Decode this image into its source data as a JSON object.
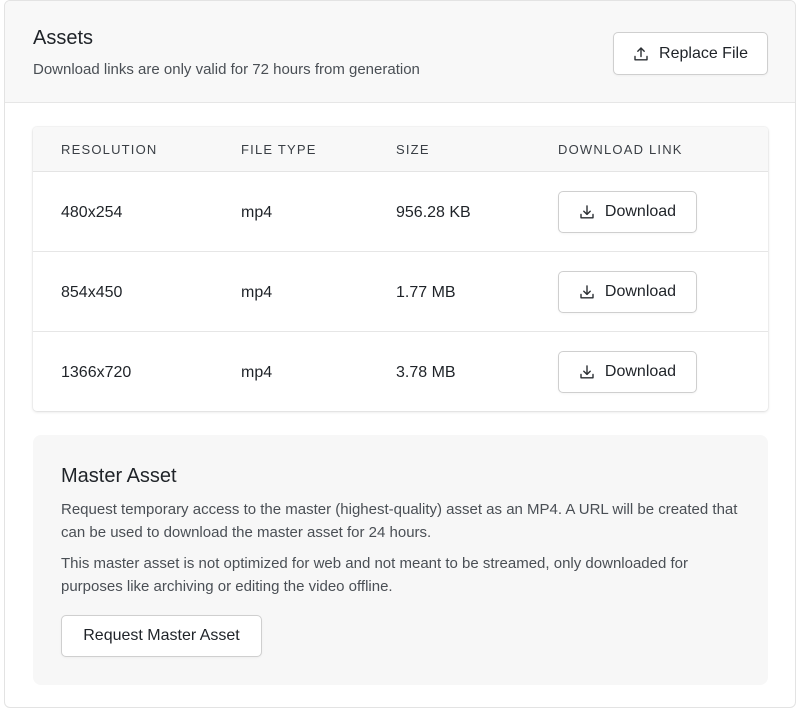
{
  "header": {
    "title": "Assets",
    "subtitle": "Download links are only valid for 72 hours from generation",
    "replace_label": "Replace File"
  },
  "table": {
    "columns": [
      "RESOLUTION",
      "FILE TYPE",
      "SIZE",
      "DOWNLOAD LINK"
    ],
    "rows": [
      {
        "resolution": "480x254",
        "file_type": "mp4",
        "size": "956.28 KB",
        "download_label": "Download"
      },
      {
        "resolution": "854x450",
        "file_type": "mp4",
        "size": "1.77 MB",
        "download_label": "Download"
      },
      {
        "resolution": "1366x720",
        "file_type": "mp4",
        "size": "3.78 MB",
        "download_label": "Download"
      }
    ]
  },
  "master": {
    "title": "Master Asset",
    "paragraph1": "Request temporary access to the master (highest-quality) asset as an MP4. A URL will be created that can be used to download the master asset for 24 hours.",
    "paragraph2": "This master asset is not optimized for web and not meant to be streamed, only downloaded for purposes like archiving or editing the video offline.",
    "button_label": "Request Master Asset"
  },
  "icons": {
    "replace": "upload-icon",
    "download": "download-icon"
  }
}
